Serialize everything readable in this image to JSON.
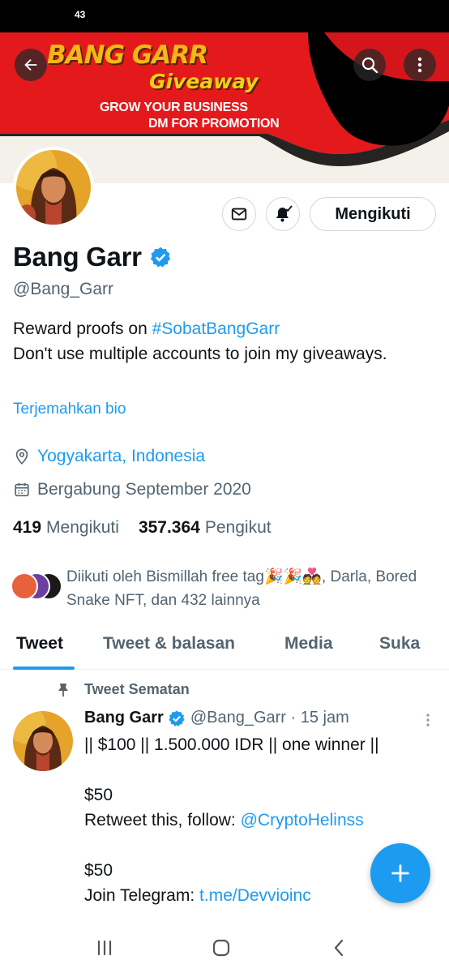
{
  "status_bar": {
    "time": "43"
  },
  "banner": {
    "title": "BANG GARR",
    "subtitle": "Giveaway",
    "line1": "GROW YOUR BUSINESS",
    "line2": "DM FOR PROMOTION"
  },
  "header": {
    "back_icon": "arrow-left-icon",
    "search_icon": "search-icon",
    "more_icon": "more-vertical-icon"
  },
  "actions": {
    "mail_icon": "mail-icon",
    "bell_icon": "bell-check-icon",
    "follow_label": "Mengikuti"
  },
  "profile": {
    "name": "Bang Garr",
    "handle": "@Bang_Garr",
    "bio_prefix": "Reward proofs on ",
    "bio_hashtag": "#SobatBangGarr",
    "bio_rest": "Don't use multiple accounts to join my giveaways.",
    "translate_label": "Terjemahkan bio",
    "location": "Yogyakarta, Indonesia",
    "joined": "Bergabung September 2020",
    "following_count": "419",
    "following_label": "Mengikuti",
    "followers_count": "357.364",
    "followers_label": "Pengikut",
    "followed_by": "Diikuti oleh Bismillah free tag🎉🎉💑, Darla, Bored Snake NFT, dan 432 lainnya"
  },
  "tabs": [
    {
      "label": "Tweet"
    },
    {
      "label": "Tweet & balasan"
    },
    {
      "label": "Media"
    },
    {
      "label": "Suka"
    }
  ],
  "pinned_tweet": {
    "pinned_label": "Tweet Sematan",
    "author_name": "Bang Garr",
    "author_handle_time": "@Bang_Garr · 15 jam",
    "line1": "|| $100 || 1.500.000 IDR || one winner ||",
    "line2": "",
    "line3": "$50",
    "line4_prefix": "Retweet this, follow: ",
    "line4_link": "@CryptoHelinss",
    "line5": "",
    "line6": "$50",
    "line7_prefix": "Join Telegram: ",
    "line7_link": "t.me/Devvioinc"
  },
  "fab": {
    "icon": "plus-icon"
  },
  "nav": {
    "recent_icon": "recent-apps-icon",
    "home_icon": "home-icon",
    "back_icon": "back-chevron-icon"
  },
  "colors": {
    "accent": "#1d9bf0",
    "text": "#0f1419",
    "secondary": "#536471",
    "banner_red": "#e3191c"
  }
}
